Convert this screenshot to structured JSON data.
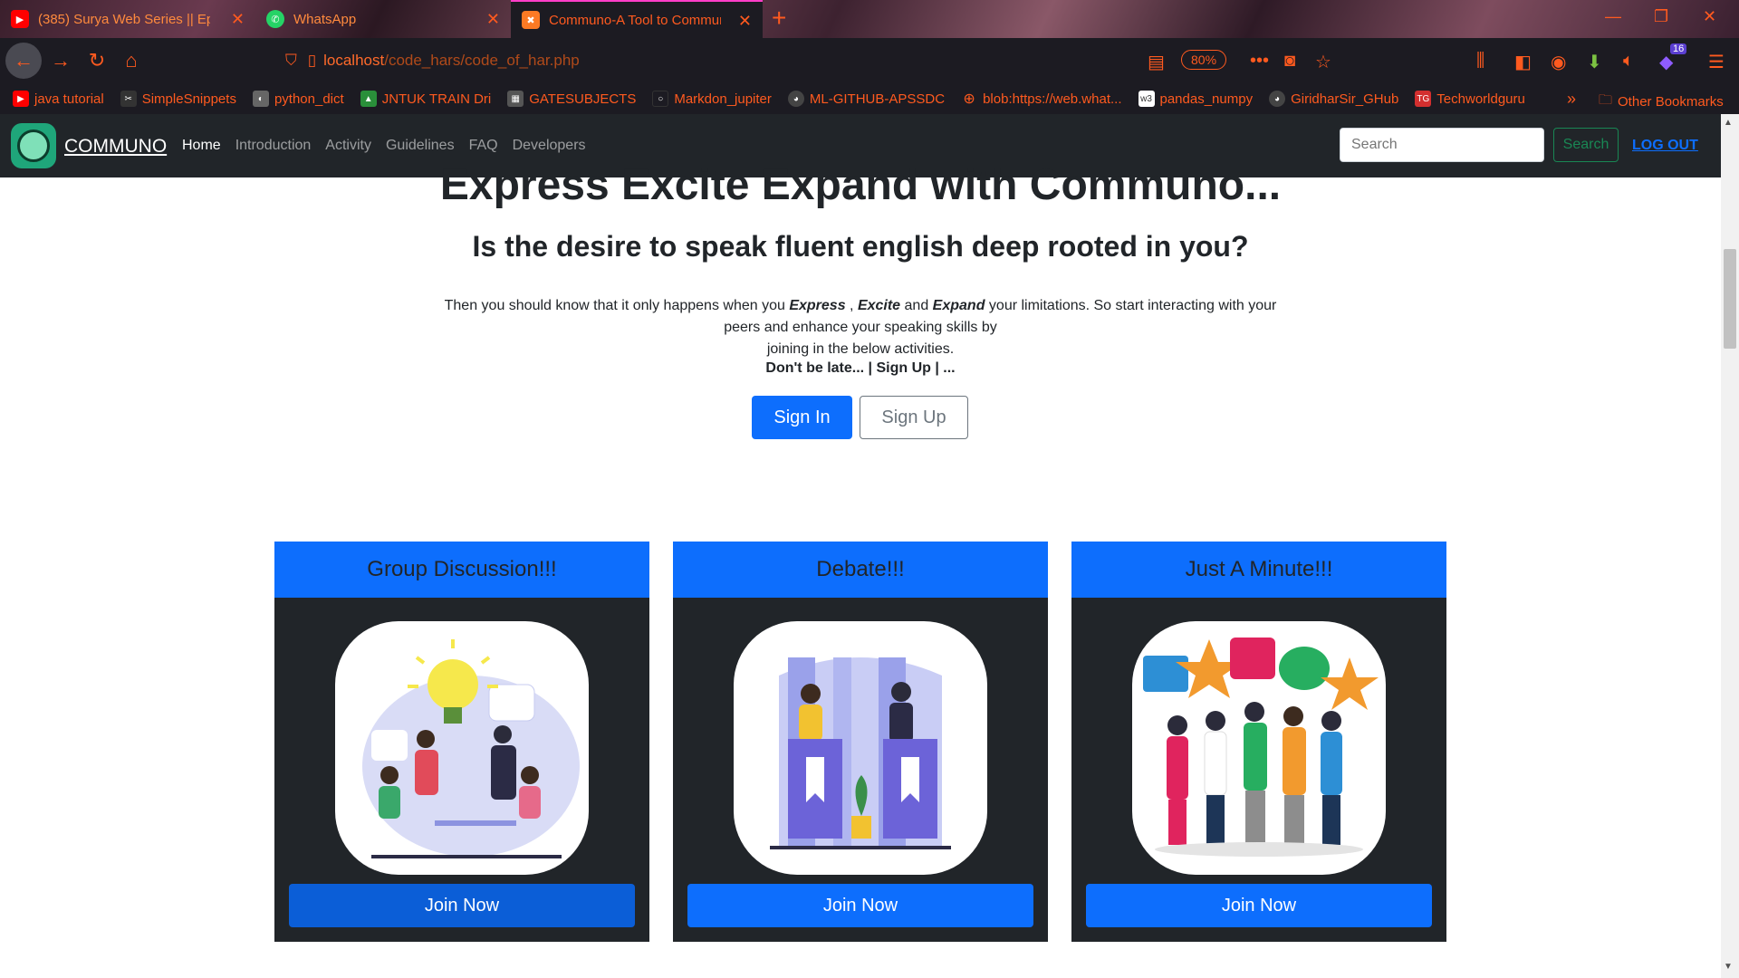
{
  "browser": {
    "tabs": [
      {
        "label": "(385) Surya Web Series || Ep",
        "icon": "youtube-icon"
      },
      {
        "label": "WhatsApp",
        "icon": "whatsapp-icon"
      },
      {
        "label": "Communo-A Tool to Communi",
        "icon": "xampp-icon"
      }
    ],
    "url_host": "localhost",
    "url_path": "/code_hars/code_of_har.php",
    "zoom": "80%",
    "badge_count": "16",
    "bookmarks": [
      {
        "label": "java tutorial",
        "icon": "youtube-icon",
        "color": "#ff0000"
      },
      {
        "label": "SimpleSnippets",
        "icon": "snippets-icon",
        "color": "#333333"
      },
      {
        "label": "python_dict",
        "icon": "page-icon",
        "color": "#666666"
      },
      {
        "label": "JNTUK TRAIN Dri",
        "icon": "drive-icon",
        "color": "#2a8f3a"
      },
      {
        "label": "GATESUBJECTS",
        "icon": "gate-icon",
        "color": "#555555"
      },
      {
        "label": "Markdon_jupiter",
        "icon": "jupyter-icon",
        "color": "#1c1b22"
      },
      {
        "label": "ML-GITHUB-APSSDC",
        "icon": "github-icon",
        "color": "#444444"
      },
      {
        "label": "blob:https://web.what...",
        "icon": "globe-icon",
        "color": "#ff5a1f"
      },
      {
        "label": "pandas_numpy",
        "icon": "w3-icon",
        "color": "#ffffff"
      },
      {
        "label": "GiridharSir_GHub",
        "icon": "github-icon",
        "color": "#444444"
      },
      {
        "label": "Techworldguru",
        "icon": "tg-icon",
        "color": "#d32f2f"
      }
    ],
    "other_bookmarks": "Other Bookmarks"
  },
  "site": {
    "brand": "COMMUNO",
    "nav": [
      "Home",
      "Introduction",
      "Activity",
      "Guidelines",
      "FAQ",
      "Developers"
    ],
    "search_placeholder": "Search",
    "search_button": "Search",
    "logout": "LOG OUT"
  },
  "hero": {
    "title": "Express Excite Expand with Communo...",
    "subtitle": "Is the desire to speak fluent english deep rooted in you?",
    "text_1": "Then you should know that it only happens when you ",
    "word_express": "Express",
    "sep": " , ",
    "word_excite": "Excite",
    "and": " and ",
    "word_expand": "Expand",
    "text_2": " your limitations. So start interacting with your peers and enhance your speaking skills by",
    "text_3": "joining in the below activities.",
    "note": "Don't be late... | Sign Up | ...",
    "signin": "Sign In",
    "signup": "Sign Up"
  },
  "cards": [
    {
      "title": "Group Discussion!!!",
      "button": "Join Now",
      "image": "group-discussion-illustration"
    },
    {
      "title": "Debate!!!",
      "button": "Join Now",
      "image": "debate-illustration"
    },
    {
      "title": "Just A Minute!!!",
      "button": "Join Now",
      "image": "just-a-minute-illustration"
    }
  ],
  "colors": {
    "primary": "#0d6efd",
    "navbar": "#212529",
    "browser_accent": "#ff5a1f",
    "success": "#198754"
  }
}
